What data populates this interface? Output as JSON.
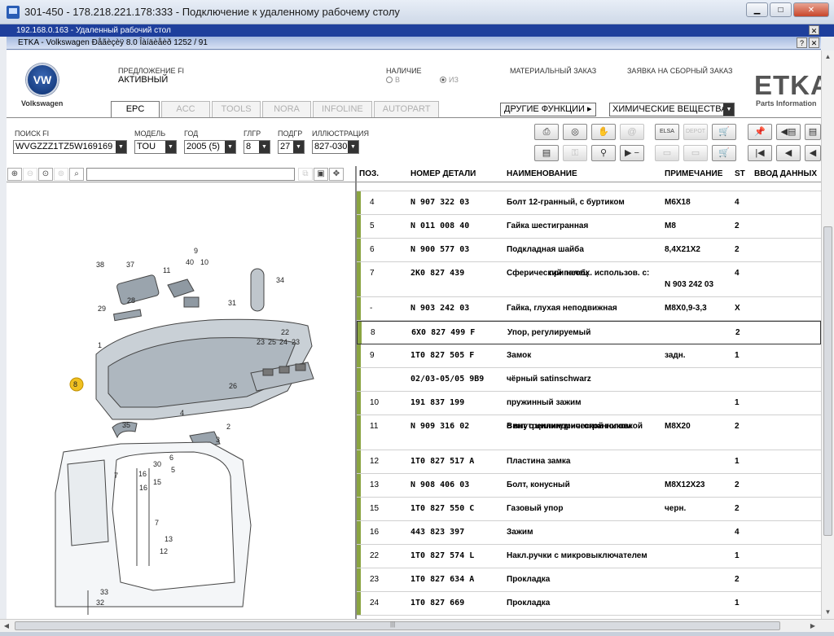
{
  "rdp": {
    "title": "301-450 - 178.218.221.178:333 - Подключение к удаленному рабочему столу",
    "bar": "192.168.0.163 - Удаленный рабочий стол",
    "min": "▁",
    "max": "□",
    "close": "✕",
    "bar_btn": "✕"
  },
  "etka_window": {
    "title": "ETKA - Volkswagen Ðåãèçèÿ 8.0 Îàíäèåèð 1252 / 91",
    "help": "?",
    "close": "✕"
  },
  "header": {
    "brand": "Volkswagen",
    "vw_mark": "VW",
    "offer_label": "ПРЕДЛОЖЕНИЕ FI",
    "offer_value": "АКТИВНЫЙ",
    "availability_label": "НАЛИЧИЕ",
    "avail_opt1": "В",
    "avail_opt2": "ИЗ",
    "material_order": "МАТЕРИАЛЬНЫЙ ЗАКАЗ",
    "assembly_order": "ЗАЯВКА НА СБОРНЫЙ ЗАКАЗ",
    "etka_logo": "ETKA",
    "etka_sub": "Parts Information"
  },
  "tabs": [
    {
      "label": "EPC"
    },
    {
      "label": "ACC"
    },
    {
      "label": "TOOLS"
    },
    {
      "label": "NORA"
    },
    {
      "label": "INFOLINE"
    },
    {
      "label": "AUTOPART"
    }
  ],
  "other_functions": "ДРУГИЕ ФУНКЦИИ ▸",
  "chem_select": "ХИМИЧЕСКИЕ ВЕЩЕСТВА",
  "filters": {
    "search_label": "ПОИСК FI",
    "search_value": "WVGZZZ1TZ5W169169",
    "model_label": "МОДЕЛЬ",
    "model_value": "TOU",
    "year_label": "ГОД",
    "year_value": "2005 (5)",
    "mg_label": "ГЛГР",
    "mg_value": "8",
    "sg_label": "ПОДГР",
    "sg_value": "27",
    "illus_label": "ИЛЛЮСТРАЦИЯ",
    "illus_value": "827-030"
  },
  "toolbar": {
    "print": "⎙",
    "cd": "◎",
    "handshake": "✋",
    "at": "@",
    "elsa": "ELSA",
    "depot": "DEPOT",
    "cart1": "🛒",
    "pin": "📌",
    "prev_page": "◀▤",
    "next_page": "▤",
    "list": "▤",
    "key": "⚿",
    "bike": "⚲",
    "step": "▶ −",
    "elsa2": "▭",
    "depot2": "▭",
    "cart2": "🛒",
    "first": "|◀",
    "prev": "◀",
    "back": "◀"
  },
  "image_toolbar": {
    "zoom_in": "⊕",
    "zoom_out": "⊖",
    "zoom_fit": "⊙",
    "zoom_sel": "⊚",
    "find": "⌕",
    "copy": "⧉",
    "frame": "▣",
    "expand": "✥"
  },
  "columns": {
    "pos": "ПОЗ.",
    "part": "НОМЕР ДЕТАЛИ",
    "name": "НАИМЕНОВАНИЕ",
    "note": "ПРИМЕЧАНИЕ",
    "st": "ST",
    "input": "ВВОД ДАННЫХ"
  },
  "rows": [
    {
      "pos": "4",
      "part": "N      907 322 03",
      "name": "Болт 12-гранный, с буртиком",
      "note": "M6X18",
      "st": "4"
    },
    {
      "pos": "5",
      "part": "N      011 008 40",
      "name": "Гайка шестигранная",
      "note": "M8",
      "st": "2"
    },
    {
      "pos": "6",
      "part": "N      900 577 03",
      "name": "Подкладная шайба",
      "note": "8,4X21X2",
      "st": "2"
    },
    {
      "pos": "7",
      "part": "2K0 827 439",
      "name": "Сферический палец",
      "name2": "при необх. использов. с:",
      "note": "",
      "note2": "N 903 242 03",
      "st": "4"
    },
    {
      "pos": "-",
      "part": "N      903 242 03",
      "name": "Гайка, глухая неподвижная",
      "note": "M8X0,9-3,3",
      "st": "X"
    },
    {
      "pos": "8",
      "part": "6X0 827 499 F",
      "name": "Упор, регулируемый",
      "note": "",
      "st": "2"
    },
    {
      "pos": "9",
      "part": "1T0 827 505 F",
      "name": "Замок",
      "note": "задн.",
      "st": "1"
    },
    {
      "pos": "",
      "part": "02/03-05/05 9B9",
      "name": "чёрный satinschwarz",
      "note": "",
      "st": ""
    },
    {
      "pos": "10",
      "part": "191 837 199",
      "name": "пружинный зажим",
      "note": "",
      "st": "1"
    },
    {
      "pos": "11",
      "part": "N      909 316 02",
      "name": "Винт с цилиндрической головкой",
      "name2": "с внутренним многогранником",
      "note": "M8X20",
      "st": "2"
    },
    {
      "pos": "12",
      "part": "1T0 827 517 A",
      "name": "Пластина замка",
      "note": "",
      "st": "1"
    },
    {
      "pos": "13",
      "part": "N      908 406 03",
      "name": "Болт, конусный",
      "note": "M8X12X23",
      "st": "2"
    },
    {
      "pos": "15",
      "part": "1T0 827 550 C",
      "name": "Газовый упор",
      "note": "черн.",
      "st": "2"
    },
    {
      "pos": "16",
      "part": "443 823 397",
      "name": "Зажим",
      "note": "",
      "st": "4"
    },
    {
      "pos": "22",
      "part": "1T0 827 574 L",
      "name": "Накл.ручки с микровыключателем",
      "note": "",
      "st": "1"
    },
    {
      "pos": "23",
      "part": "1T0 827 634 A",
      "name": "Прокладка",
      "note": "",
      "st": "2"
    },
    {
      "pos": "24",
      "part": "1T0 827 669",
      "name": "Прокладка",
      "note": "",
      "st": "1"
    }
  ],
  "illustration": {
    "labels": [
      "38",
      "37",
      "9",
      "11",
      "40",
      "10",
      "34",
      "29",
      "28",
      "31",
      "1",
      "22",
      "23",
      "25",
      "24",
      "23",
      "8",
      "26",
      "4",
      "35",
      "2",
      "3",
      "6",
      "30",
      "5",
      "7",
      "16",
      "15",
      "16",
      "7",
      "13",
      "12",
      "33",
      "32"
    ]
  },
  "scroll": {
    "up": "▲",
    "down": "▼",
    "left": "◀",
    "right": "▶",
    "grip": "|||"
  }
}
